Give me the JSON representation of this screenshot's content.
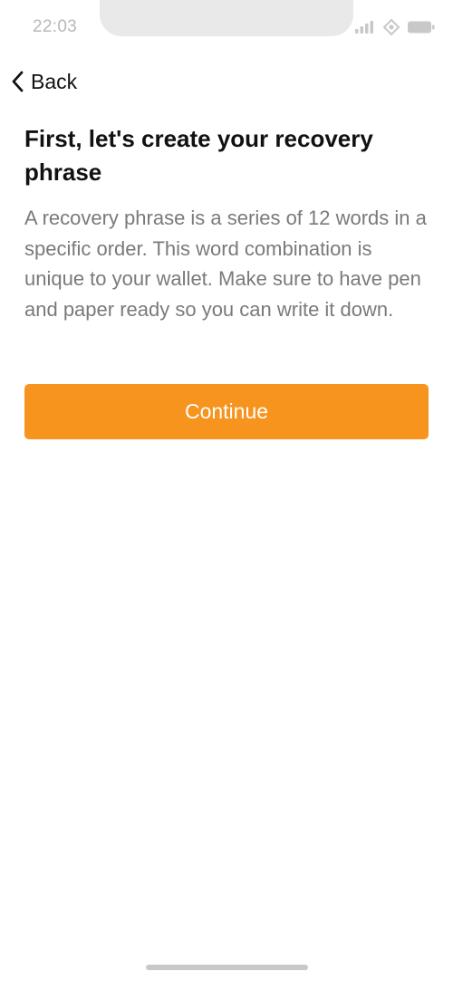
{
  "status_bar": {
    "time": "22:03",
    "icons": [
      "signal-icon",
      "wifi-icon",
      "battery-icon"
    ]
  },
  "nav": {
    "back_label": "Back",
    "back_icon": "chevron-left-icon"
  },
  "content": {
    "title": "First, let's create your recovery phrase",
    "description": "A recovery phrase is a series of 12 words in a specific order. This word combination is unique to your wallet. Make sure to have pen and paper ready so you can write it down."
  },
  "actions": {
    "continue_label": "Continue"
  },
  "colors": {
    "accent": "#f7941d",
    "text_primary": "#111111",
    "text_secondary": "#7a7a7a",
    "status_text": "#b8b8b8"
  }
}
